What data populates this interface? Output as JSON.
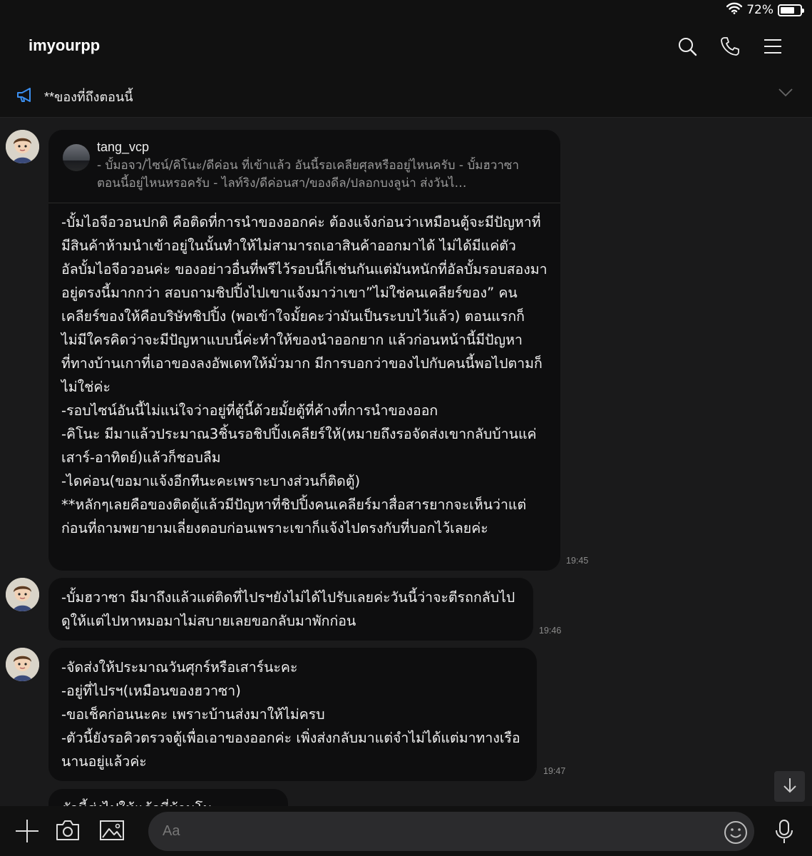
{
  "status_bar": {
    "battery": "72%",
    "battery_level": 0.72
  },
  "header": {
    "title": "imyourpp",
    "icons": [
      "search-icon",
      "phone-icon",
      "menu-icon"
    ]
  },
  "announcement": {
    "text": "**ของที่ถึงตอนนี้"
  },
  "messages": [
    {
      "reply": {
        "name": "tang_vcp",
        "snippet": "- บั้มอจว/ไซน์/คิโนะ/ดีค่อน ที่เข้าแล้ว อันนี้รอเคลียศุลหรืออยู่ไหนครับ - บั้มฮวาซา ตอนนี้อยู่ไหนหรอครับ - ไลท์ริง/ดีค่อนสา/ของดีล/ปลอกบงลูน่า ส่งวันไ…"
      },
      "text": "-บั้มไอจีอวอนปกติ คือติดที่การนำของออกค่ะ ต้องแจ้งก่อนว่าเหมือนตู้จะมีปัญหาที่มีสินค้าห้ามนำเข้าอยู่ในนั้นทำให้ไม่สามารถเอาสินค้าออกมาได้ ไม่ได้มีแค่ตัวอัลบั้มไอจีอวอนค่ะ ของอย่าวอื่นที่พรีไว้รอบนี้ก็เช่นกันแต่มันหนักที่อัลบั้มรอบสองมาอยู่ตรงนี้มากกว่า สอบถามชิปปิ้งไปเขาแจ้งมาว่าเขา”ไม่ใช่คนเคลียร์ของ” คนเคลียร์ของให้คือบริษัทชิปปิ้ง (พอเข้าใจมั้ยคะว่ามันเป็นระบบไว้แล้ว) ตอนแรกก็ไม่มีใครคิดว่าจะมีปัญหาแบบนี้ค่ะทำให้ของนำออกยาก แล้วก่อนหน้านี้มีปัญหาที่ทางบ้านเกาที่เอาของลงอัพเดทให้มั่วมาก มีการบอกว่าของไปกับคนนี้พอไปตามก็ไม่ใช่ค่ะ\n-รอบไซน์อันนี้ไม่แน่ใจว่าอยู่ที่ตู้นี้ด้วยมั้ยตู้ที่ค้างที่การนำของออก\n-คิโนะ มีมาแล้วประมาณ3ชิ้นรอชิปปิ้งเคลียร์ให้(หมายถึงรอจัดส่งเขากลับบ้านแค่เสาร์-อาทิตย์)แล้วก็ชอบลืม\n-ไดค่อน(ขอมาแจ้งอีกทีนะคะเพราะบางส่วนก็ติดตู้)\n**หลักๆเลยคือของติดตู้แล้วมีปัญหาที่ชิปปิ้งคนเคลียร์มาสื่อสารยากจะเห็นว่าแต่ก่อนที่ถามพยายามเลี่ยงตอบก่อนเพราะเขาก็แจ้งไปตรงกับที่บอกไว้เลยค่ะ",
      "time": "19:45"
    },
    {
      "text": "-บั้มฮวาซา มีมาถึงแล้วแต่ติดที่ไปรฯยังไม่ได้ไปรับเลยค่ะวันนี้ว่าจะตีรถกลับไปดูให้แต่ไปหาหมอมาไม่สบายเลยขอกลับมาพักก่อน",
      "time": "19:46"
    },
    {
      "text": "-จัดส่งให้ประมาณวันศุกร์หรือเสาร์นะคะ\n-อยู่ที่ไปรฯ(เหมือนของฮวาซา)\n-ขอเช็คก่อนนะคะ เพราะบ้านส่งมาให้ไม่ครบ\n-ตัวนี้ยังรอคิวตรวจตู้เพื่อเอาของออกค่ะ เพิ่งส่งกลับมาแต่จำไม่ได้แต่มาทางเรือนานอยู่แล้วค่ะ",
      "time": "19:47"
    },
    {
      "text": "ตัวนี้ส่งไปให้แล้วที่บ้านโน",
      "time": ""
    }
  ],
  "input": {
    "placeholder": "Aa"
  }
}
